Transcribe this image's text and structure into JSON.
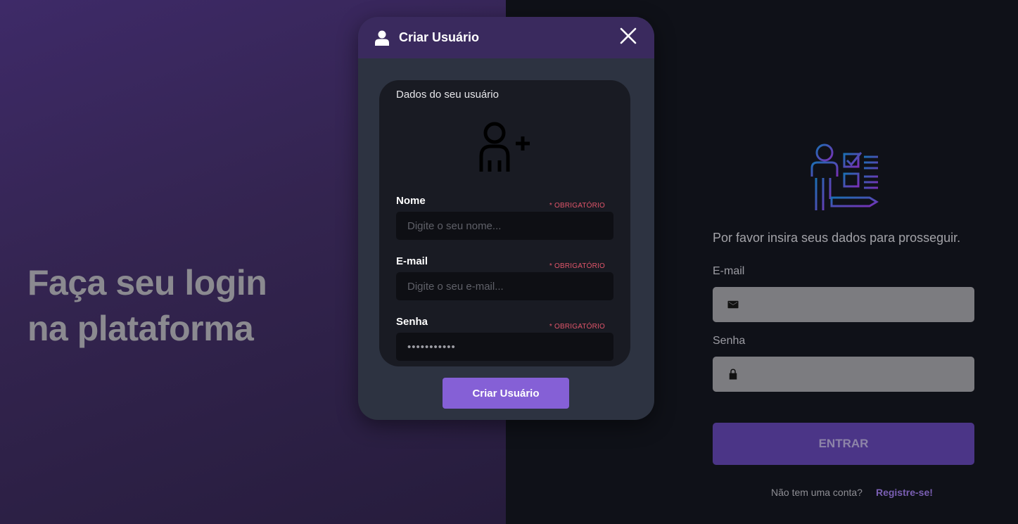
{
  "left": {
    "headline_line1": "Faça seu login",
    "headline_line2": "na plataforma"
  },
  "login": {
    "illustration": "form-checklist-illustration",
    "prompt": "Por favor insira seus dados para prosseguir.",
    "email_label": "E-mail",
    "email_icon": "mail-icon",
    "password_label": "Senha",
    "password_icon": "lock-icon",
    "submit_label": "ENTRAR",
    "register_question": "Não tem uma conta?",
    "register_link": "Registre-se!"
  },
  "modal": {
    "title": "Criar Usuário",
    "header_icon": "user-icon",
    "close_icon": "close-icon",
    "card_title": "Dados do seu usuário",
    "card_icon": "user-add-icon",
    "fields": [
      {
        "label": "Nome",
        "required": "* OBRIGATÓRIO",
        "placeholder": "Digite o seu nome...",
        "value": ""
      },
      {
        "label": "E-mail",
        "required": "* OBRIGATÓRIO",
        "placeholder": "Digite o seu e-mail...",
        "value": ""
      },
      {
        "label": "Senha",
        "required": "* OBRIGATÓRIO",
        "placeholder": "",
        "value": "•••••••••••"
      }
    ],
    "submit_label": "Criar Usuário"
  },
  "colors": {
    "accent": "#8560d6",
    "enter_button": "#4b3587",
    "header": "#3a2a5e",
    "required": "#e0556a"
  }
}
